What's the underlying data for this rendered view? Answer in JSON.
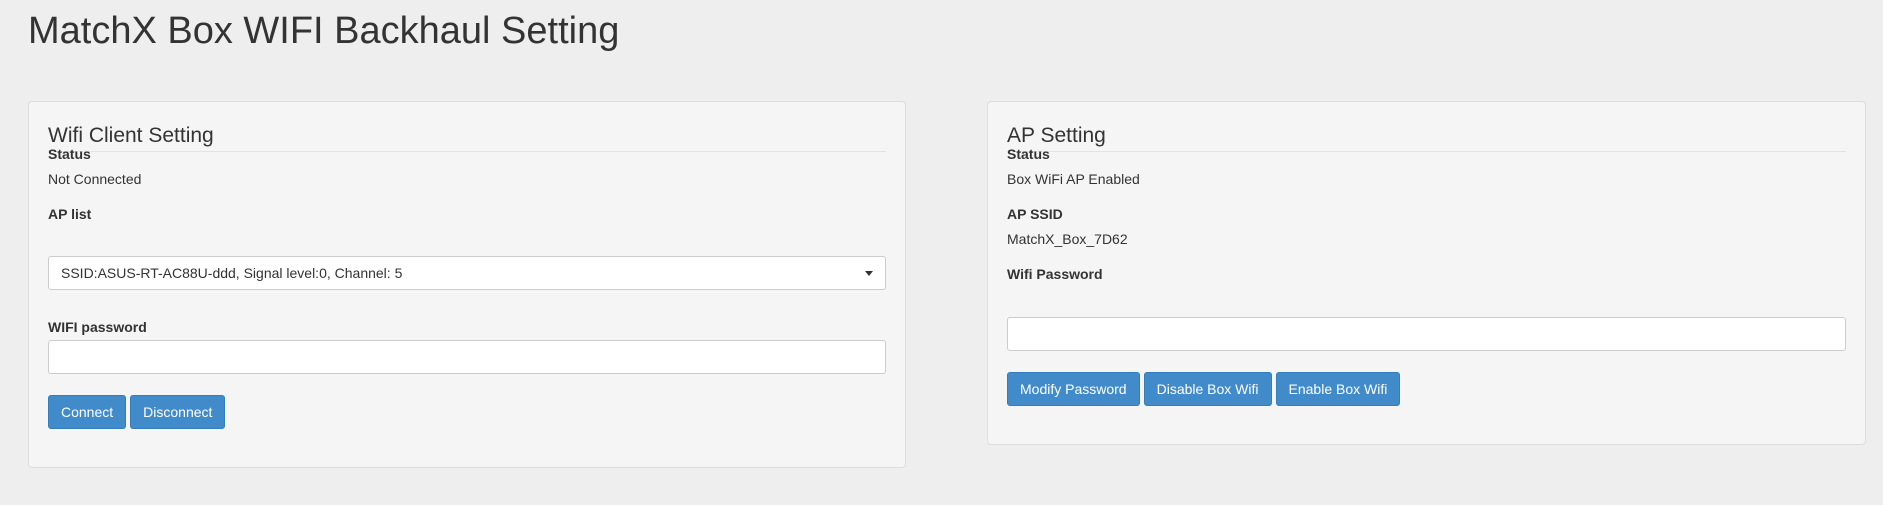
{
  "page": {
    "title": "MatchX Box WIFI Backhaul Setting"
  },
  "wifi_client": {
    "heading": "Wifi Client Setting",
    "status_label": "Status",
    "status_value": "Not Connected",
    "ap_list_label": "AP list",
    "ap_list_selected": "SSID:ASUS-RT-AC88U-ddd, Signal level:0, Channel: 5",
    "password_label": "WIFI password",
    "password_value": "",
    "connect_label": "Connect",
    "disconnect_label": "Disconnect"
  },
  "ap_setting": {
    "heading": "AP Setting",
    "status_label": "Status",
    "status_value": "Box WiFi AP Enabled",
    "ssid_label": "AP SSID",
    "ssid_value": "MatchX_Box_7D62",
    "password_label": "Wifi Password",
    "password_value": "",
    "modify_label": "Modify Password",
    "disable_label": "Disable Box Wifi",
    "enable_label": "Enable Box Wifi"
  },
  "colors": {
    "background": "#eeeeee",
    "panel": "#f5f5f5",
    "button": "#428bca"
  }
}
